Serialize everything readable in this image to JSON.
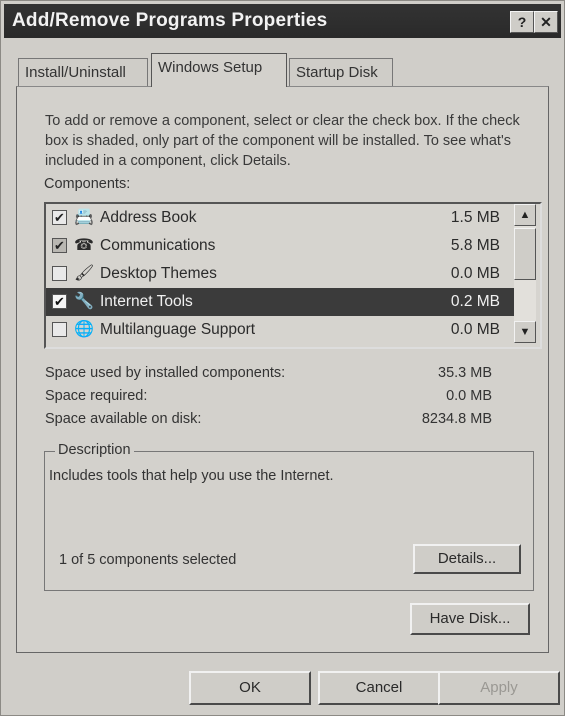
{
  "window": {
    "title": "Add/Remove Programs Properties",
    "help_button": "?",
    "close_button": "✕"
  },
  "tabs": [
    {
      "label": "Install/Uninstall",
      "active": false
    },
    {
      "label": "Windows Setup",
      "active": true
    },
    {
      "label": "Startup Disk",
      "active": false
    }
  ],
  "intro_text": "To add or remove a component, select or clear the check box. If the check box is shaded, only part of the component will be installed. To see what's included in a component, click Details.",
  "components_label": "Components:",
  "components": [
    {
      "name": "Address Book",
      "size": "1.5 MB",
      "state": "checked",
      "icon": "address-book-icon"
    },
    {
      "name": "Communications",
      "size": "5.8 MB",
      "state": "shaded",
      "icon": "communications-icon"
    },
    {
      "name": "Desktop Themes",
      "size": "0.0 MB",
      "state": "unchecked",
      "icon": "desktop-themes-icon"
    },
    {
      "name": "Internet Tools",
      "size": "0.2 MB",
      "state": "checked",
      "icon": "internet-tools-icon",
      "selected": true
    },
    {
      "name": "Multilanguage Support",
      "size": "0.0 MB",
      "state": "unchecked",
      "icon": "globe-icon"
    }
  ],
  "space": {
    "used_label": "Space used by installed components:",
    "used_value": "35.3 MB",
    "required_label": "Space required:",
    "required_value": "0.0 MB",
    "available_label": "Space available on disk:",
    "available_value": "8234.8 MB"
  },
  "description": {
    "title": "Description",
    "text": "Includes tools that help you use the Internet.",
    "selected_count": "1 of 5 components selected",
    "details_button": "Details..."
  },
  "have_disk_button": "Have Disk...",
  "footer": {
    "ok": "OK",
    "cancel": "Cancel",
    "apply": "Apply"
  }
}
